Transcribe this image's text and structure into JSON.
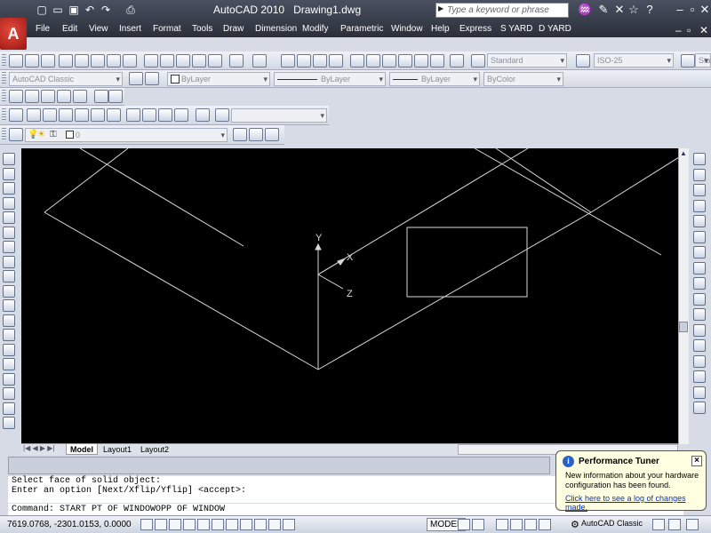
{
  "title": {
    "app": "AutoCAD 2010",
    "document": "Drawing1.dwg"
  },
  "search": {
    "placeholder": "Type a keyword or phrase"
  },
  "menus": [
    "File",
    "Edit",
    "View",
    "Insert",
    "Format",
    "Tools",
    "Draw",
    "Dimension",
    "Modify",
    "Parametric",
    "Window",
    "Help",
    "Express",
    "S YARD",
    "D YARD"
  ],
  "toolbar": {
    "text_style": "Standard",
    "dim_style": "ISO-25",
    "table_style_partial": "Sta",
    "workspace": "AutoCAD Classic",
    "color": "ByLayer",
    "linetype": "ByLayer",
    "lineweight": "ByLayer",
    "plotstyle": "ByColor",
    "layer": "0"
  },
  "ucs": {
    "y": "Y",
    "x": "X",
    "z": "Z"
  },
  "layout_tabs": [
    "Model",
    "Layout1",
    "Layout2"
  ],
  "command": {
    "line1": "Select face of solid object:",
    "line2": "Enter an option [Next/Xflip/Yflip] <accept>:",
    "input": "Command: START PT OF WINDOWOPP OF WINDOW"
  },
  "status": {
    "coords": "7619.0768, -2301.0153, 0.0000",
    "model": "MODEL",
    "workspace": "AutoCAD Classic"
  },
  "balloon": {
    "title": "Performance Tuner",
    "body": "New information about your hardware configuration has been found.",
    "link": "Click here to see a log of changes made."
  }
}
